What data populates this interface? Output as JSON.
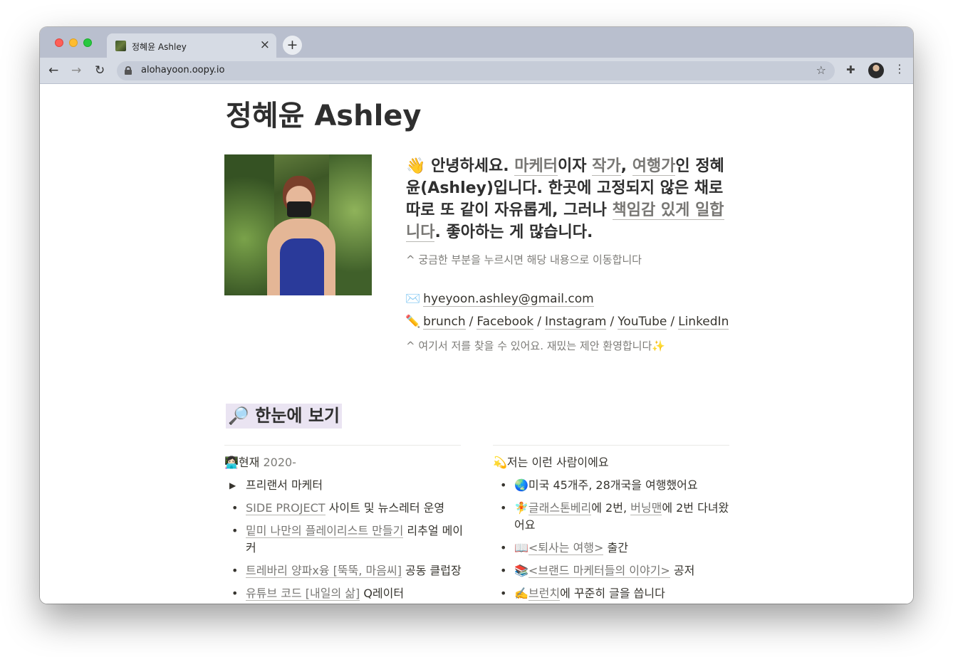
{
  "browser": {
    "tab": {
      "title": "정혜윤 Ashley"
    },
    "url": "alohayoon.oopy.io"
  },
  "page": {
    "title": "정혜윤 Ashley",
    "intro": {
      "emoji": "👋",
      "p1": " 안녕하세요. ",
      "marketer": "마케터",
      "p2": "이자 ",
      "writer": "작가",
      "p3": ", ",
      "traveler": "여행가",
      "p4": "인 정혜윤(Ashley)입니다. 한곳에 고정되지 않은 채로 따로 또 같이 자유롭게, 그러나 ",
      "responsibility": "책임감 있게 일합니다",
      "p5": ". 좋아하는 게 많습니다."
    },
    "hint1": "^ 궁금한 부분을 누르시면 해당 내용으로 이동합니다",
    "email_icon": "✉️",
    "email": "hyeyoon.ashley@gmail.com",
    "links_icon": "✏️",
    "links": [
      "brunch",
      "Facebook",
      "Instagram",
      "YouTube",
      "LinkedIn"
    ],
    "separator": "/",
    "hint2": "^ 여기서 저를 찾을 수 있어요. 재밌는 제안 환영합니다✨",
    "section_heading": "🔎 한눈에 보기",
    "left_col": {
      "head_emoji": "👩🏻‍💻",
      "head": "현재 ",
      "year": "2020-",
      "items": [
        {
          "text": "프리랜서 마케터"
        },
        {
          "link": "SIDE PROJECT",
          "rest": " 사이트 및 뉴스레터 운영"
        },
        {
          "link": "밑미 나만의 플레이리스트 만들기",
          "rest": " 리추얼 메이커"
        },
        {
          "link": "트레바리 양파x융 [뚝뚝, 마음씨]",
          "rest": " 공동 클럽장"
        },
        {
          "link": "유튜브 코드 [내일의 삶]",
          "rest": " Q레이터"
        }
      ]
    },
    "right_col": {
      "head_emoji": "💫",
      "head": "저는 이런 사람이에요",
      "items": [
        {
          "emoji": "🌏",
          "text": "미국 45개주, 28개국을 여행했어요"
        },
        {
          "emoji": "🧚",
          "link1": "글래스톤베리",
          "mid": "에 2번, ",
          "link2": "버닝맨",
          "rest": "에 2번 다녀왔어요"
        },
        {
          "emoji": "📖",
          "link": "<퇴사는 여행>",
          "rest": " 출간"
        },
        {
          "emoji": "📚",
          "link": "<브랜드 마케터들의 이야기>",
          "rest": " 공저"
        },
        {
          "emoji": "✍️",
          "link": "브런치",
          "rest": "에 꾸준히 글을 씁니다"
        }
      ]
    }
  }
}
